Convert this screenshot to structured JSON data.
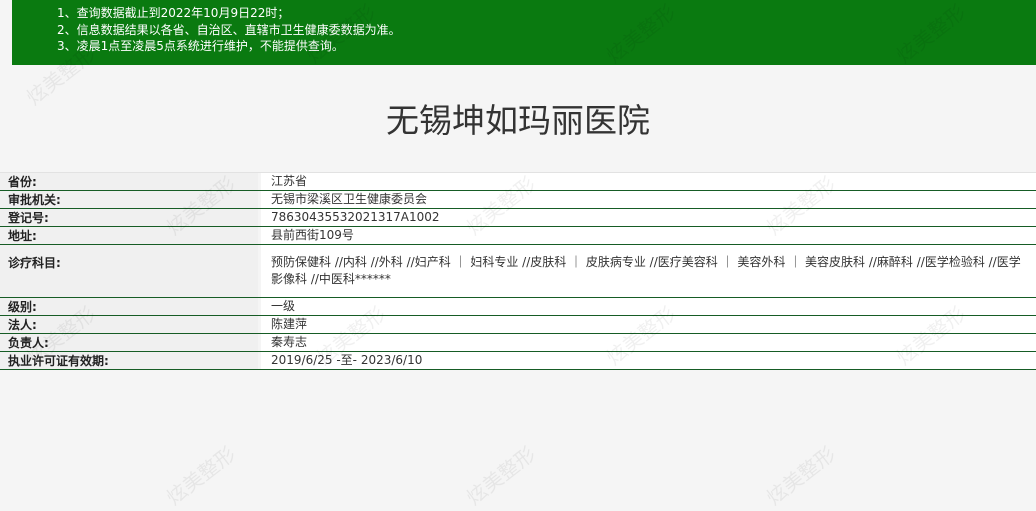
{
  "notice": {
    "lines": [
      "1、查询数据截止到2022年10月9日22时；",
      "2、信息数据结果以各省、自治区、直辖市卫生健康委数据为准。",
      "3、凌晨1点至凌晨5点系统进行维护，不能提供查询。"
    ]
  },
  "hospital": {
    "name": "无锡坤如玛丽医院"
  },
  "rows": [
    {
      "label": "省份:",
      "value": "江苏省"
    },
    {
      "label": "审批机关:",
      "value": "无锡市梁溪区卫生健康委员会"
    },
    {
      "label": "登记号:",
      "value": "78630435532021317A1002"
    },
    {
      "label": "地址:",
      "value": "县前西街109号"
    },
    {
      "label": "诊疗科目:",
      "value": "预防保健科 //内科 //外科 //妇产科 ｜ 妇科专业 //皮肤科 ｜ 皮肤病专业 //医疗美容科 ｜ 美容外科 ｜ 美容皮肤科 //麻醉科 //医学检验科 //医学影像科 //中医科******"
    },
    {
      "label": "级别:",
      "value": "一级"
    },
    {
      "label": "法人:",
      "value": "陈建萍"
    },
    {
      "label": "负责人:",
      "value": "秦寿志"
    },
    {
      "label": "执业许可证有效期:",
      "value": "2019/6/25 -至- 2023/6/10"
    }
  ],
  "watermark": {
    "text": "炫美整形"
  }
}
